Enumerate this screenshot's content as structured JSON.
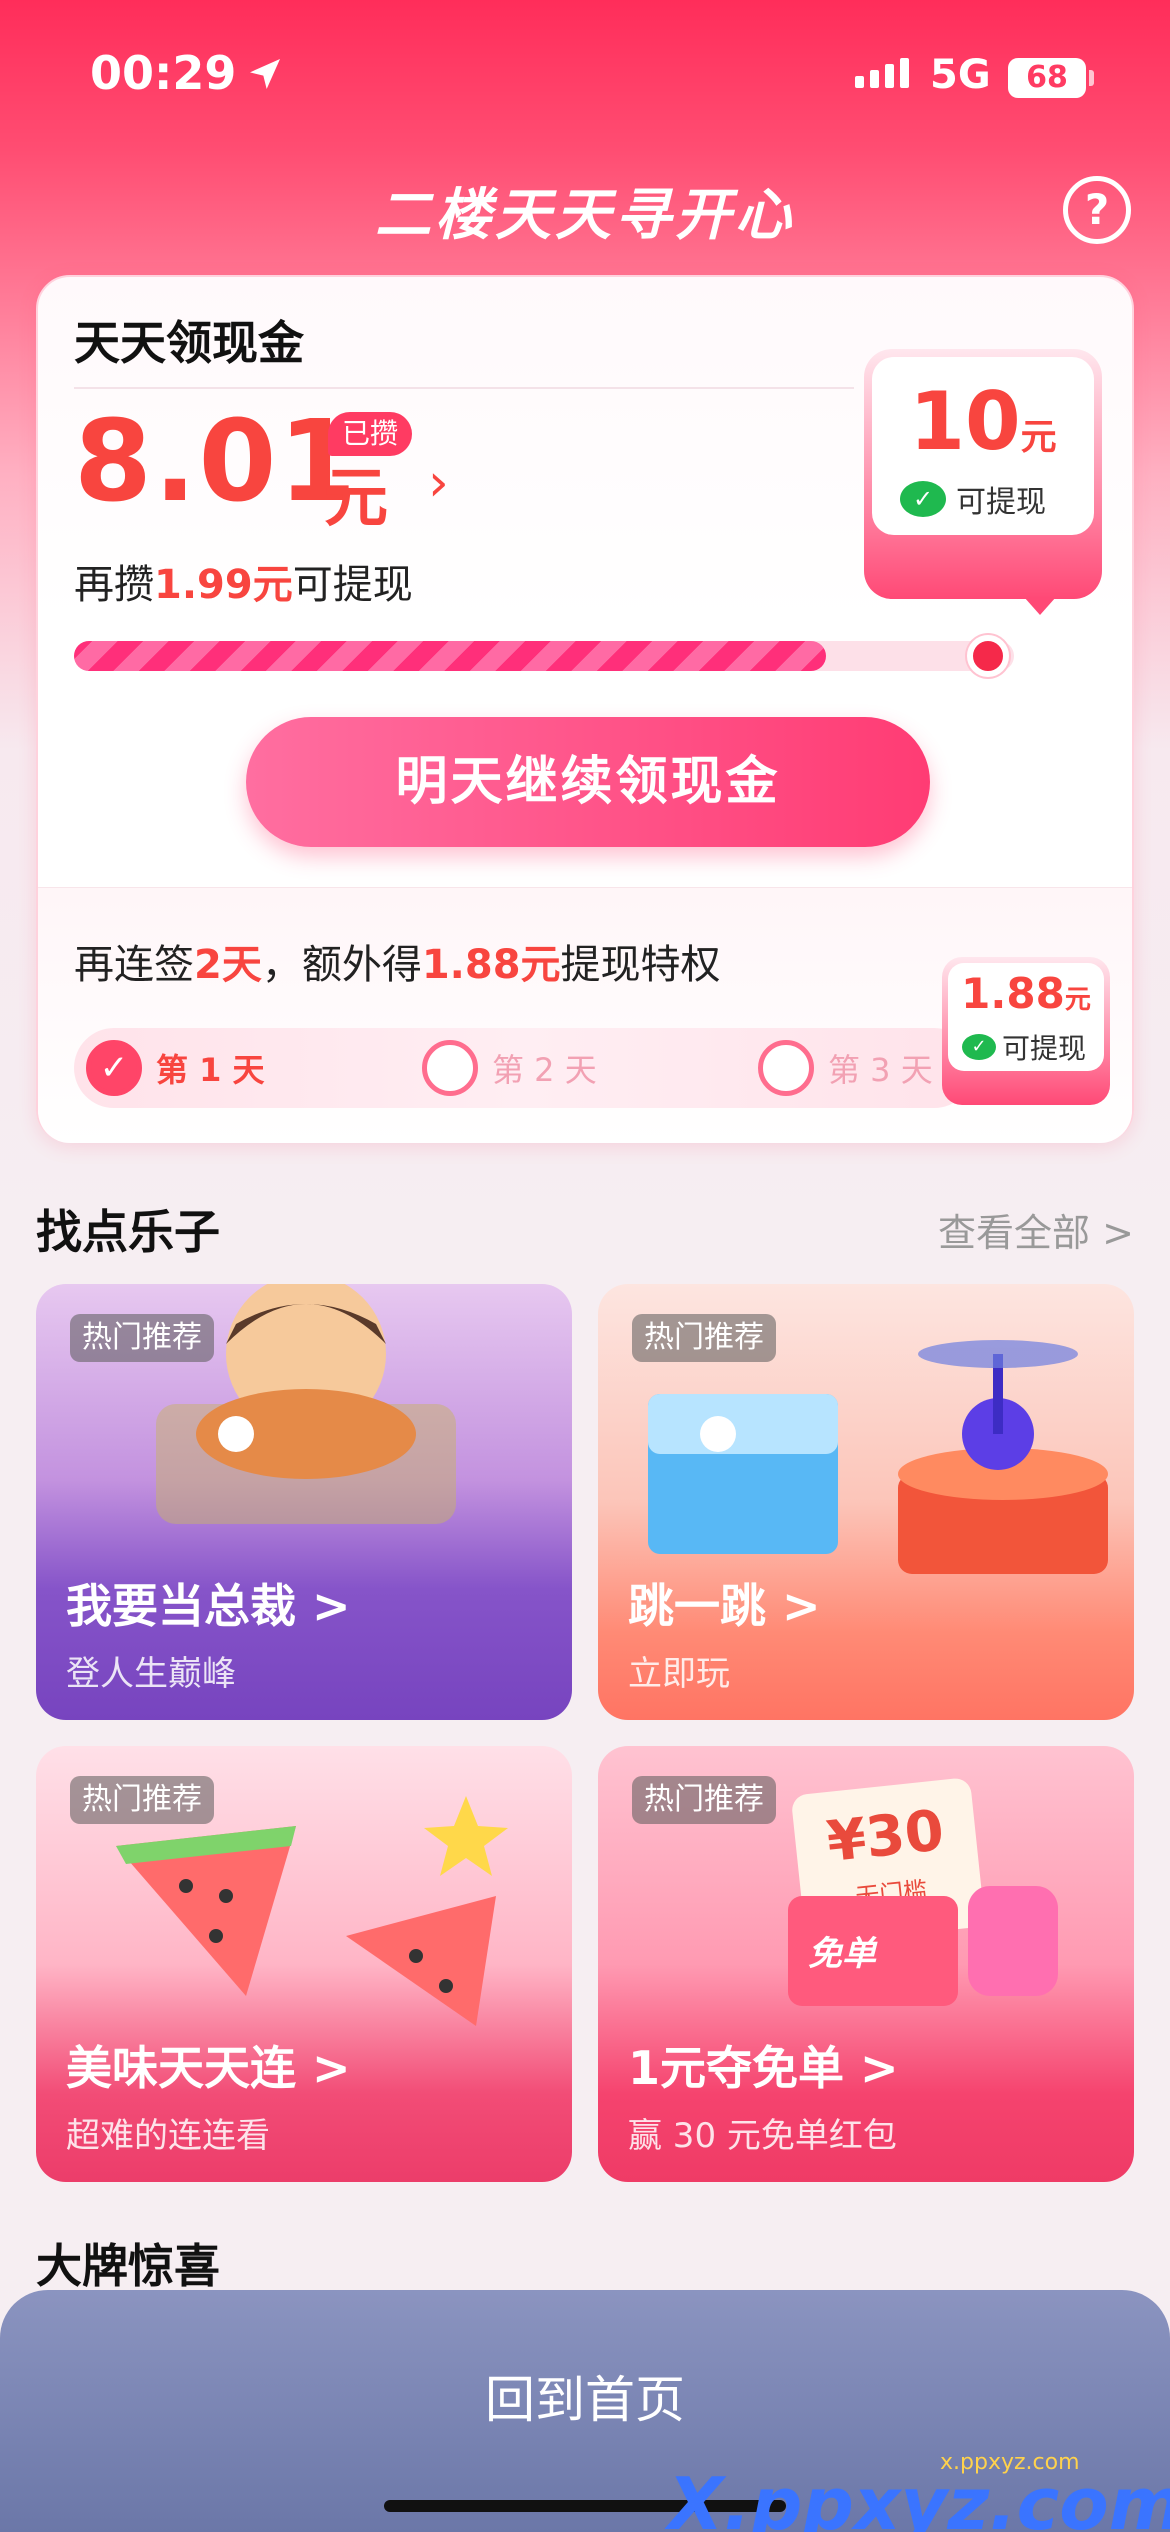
{
  "status": {
    "time": "00:29",
    "network": "5G",
    "battery": "68"
  },
  "header": {
    "title": "二楼天天寻开心",
    "help": "?"
  },
  "cash": {
    "title": "天天领现金",
    "amount": "8.01",
    "unit": "元",
    "saved_badge": "已攒",
    "need_prefix": "再攒",
    "need_value": "1.99元",
    "need_suffix": "可提现",
    "progress": 0.8,
    "goal_value": "10",
    "goal_unit": "元",
    "goal_label": "可提现",
    "button": "明天继续领现金",
    "sign_prefix": "再连签",
    "sign_days": "2天",
    "sign_mid": "，额外得",
    "sign_amount": "1.88元",
    "sign_suffix": "提现特权",
    "days": [
      {
        "label": "第 1 天",
        "done": true
      },
      {
        "label": "第 2 天",
        "done": false
      },
      {
        "label": "第 3 天",
        "done": false
      }
    ],
    "bonus_value": "1.88",
    "bonus_unit": "元",
    "bonus_label": "可提现"
  },
  "section_fun": {
    "title": "找点乐子",
    "see_all": "查看全部 >"
  },
  "games": [
    {
      "tag": "热门推荐",
      "name": "我要当总裁 >",
      "sub": "登人生巅峰"
    },
    {
      "tag": "热门推荐",
      "name": "跳一跳 >",
      "sub": "立即玩"
    },
    {
      "tag": "热门推荐",
      "name": "美味天天连 >",
      "sub": "超难的连连看"
    },
    {
      "tag": "热门推荐",
      "name": "1元夺免单 >",
      "sub": "赢 30 元免单红包"
    }
  ],
  "coupon": {
    "amount": "¥30",
    "sub": "无门槛",
    "label": "免单"
  },
  "section_brand": {
    "title": "大牌惊喜"
  },
  "bottom": {
    "back": "回到首页"
  },
  "watermark": {
    "text": "X.ppxyz.com",
    "sub": "x.ppxyz.com"
  },
  "colors": {
    "accent": "#f8453f",
    "brand": "#ff3b62",
    "wechat": "#1fb94f"
  }
}
